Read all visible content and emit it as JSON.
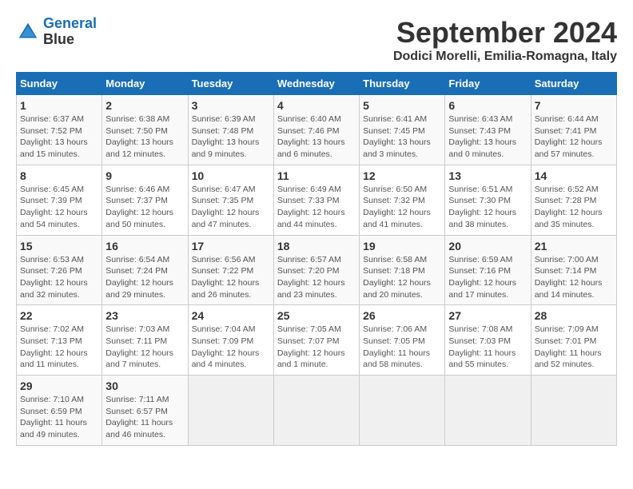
{
  "logo": {
    "line1": "General",
    "line2": "Blue"
  },
  "title": "September 2024",
  "subtitle": "Dodici Morelli, Emilia-Romagna, Italy",
  "days_of_week": [
    "Sunday",
    "Monday",
    "Tuesday",
    "Wednesday",
    "Thursday",
    "Friday",
    "Saturday"
  ],
  "weeks": [
    [
      {
        "day": "1",
        "sunrise": "Sunrise: 6:37 AM",
        "sunset": "Sunset: 7:52 PM",
        "daylight": "Daylight: 13 hours and 15 minutes."
      },
      {
        "day": "2",
        "sunrise": "Sunrise: 6:38 AM",
        "sunset": "Sunset: 7:50 PM",
        "daylight": "Daylight: 13 hours and 12 minutes."
      },
      {
        "day": "3",
        "sunrise": "Sunrise: 6:39 AM",
        "sunset": "Sunset: 7:48 PM",
        "daylight": "Daylight: 13 hours and 9 minutes."
      },
      {
        "day": "4",
        "sunrise": "Sunrise: 6:40 AM",
        "sunset": "Sunset: 7:46 PM",
        "daylight": "Daylight: 13 hours and 6 minutes."
      },
      {
        "day": "5",
        "sunrise": "Sunrise: 6:41 AM",
        "sunset": "Sunset: 7:45 PM",
        "daylight": "Daylight: 13 hours and 3 minutes."
      },
      {
        "day": "6",
        "sunrise": "Sunrise: 6:43 AM",
        "sunset": "Sunset: 7:43 PM",
        "daylight": "Daylight: 13 hours and 0 minutes."
      },
      {
        "day": "7",
        "sunrise": "Sunrise: 6:44 AM",
        "sunset": "Sunset: 7:41 PM",
        "daylight": "Daylight: 12 hours and 57 minutes."
      }
    ],
    [
      {
        "day": "8",
        "sunrise": "Sunrise: 6:45 AM",
        "sunset": "Sunset: 7:39 PM",
        "daylight": "Daylight: 12 hours and 54 minutes."
      },
      {
        "day": "9",
        "sunrise": "Sunrise: 6:46 AM",
        "sunset": "Sunset: 7:37 PM",
        "daylight": "Daylight: 12 hours and 50 minutes."
      },
      {
        "day": "10",
        "sunrise": "Sunrise: 6:47 AM",
        "sunset": "Sunset: 7:35 PM",
        "daylight": "Daylight: 12 hours and 47 minutes."
      },
      {
        "day": "11",
        "sunrise": "Sunrise: 6:49 AM",
        "sunset": "Sunset: 7:33 PM",
        "daylight": "Daylight: 12 hours and 44 minutes."
      },
      {
        "day": "12",
        "sunrise": "Sunrise: 6:50 AM",
        "sunset": "Sunset: 7:32 PM",
        "daylight": "Daylight: 12 hours and 41 minutes."
      },
      {
        "day": "13",
        "sunrise": "Sunrise: 6:51 AM",
        "sunset": "Sunset: 7:30 PM",
        "daylight": "Daylight: 12 hours and 38 minutes."
      },
      {
        "day": "14",
        "sunrise": "Sunrise: 6:52 AM",
        "sunset": "Sunset: 7:28 PM",
        "daylight": "Daylight: 12 hours and 35 minutes."
      }
    ],
    [
      {
        "day": "15",
        "sunrise": "Sunrise: 6:53 AM",
        "sunset": "Sunset: 7:26 PM",
        "daylight": "Daylight: 12 hours and 32 minutes."
      },
      {
        "day": "16",
        "sunrise": "Sunrise: 6:54 AM",
        "sunset": "Sunset: 7:24 PM",
        "daylight": "Daylight: 12 hours and 29 minutes."
      },
      {
        "day": "17",
        "sunrise": "Sunrise: 6:56 AM",
        "sunset": "Sunset: 7:22 PM",
        "daylight": "Daylight: 12 hours and 26 minutes."
      },
      {
        "day": "18",
        "sunrise": "Sunrise: 6:57 AM",
        "sunset": "Sunset: 7:20 PM",
        "daylight": "Daylight: 12 hours and 23 minutes."
      },
      {
        "day": "19",
        "sunrise": "Sunrise: 6:58 AM",
        "sunset": "Sunset: 7:18 PM",
        "daylight": "Daylight: 12 hours and 20 minutes."
      },
      {
        "day": "20",
        "sunrise": "Sunrise: 6:59 AM",
        "sunset": "Sunset: 7:16 PM",
        "daylight": "Daylight: 12 hours and 17 minutes."
      },
      {
        "day": "21",
        "sunrise": "Sunrise: 7:00 AM",
        "sunset": "Sunset: 7:14 PM",
        "daylight": "Daylight: 12 hours and 14 minutes."
      }
    ],
    [
      {
        "day": "22",
        "sunrise": "Sunrise: 7:02 AM",
        "sunset": "Sunset: 7:13 PM",
        "daylight": "Daylight: 12 hours and 11 minutes."
      },
      {
        "day": "23",
        "sunrise": "Sunrise: 7:03 AM",
        "sunset": "Sunset: 7:11 PM",
        "daylight": "Daylight: 12 hours and 7 minutes."
      },
      {
        "day": "24",
        "sunrise": "Sunrise: 7:04 AM",
        "sunset": "Sunset: 7:09 PM",
        "daylight": "Daylight: 12 hours and 4 minutes."
      },
      {
        "day": "25",
        "sunrise": "Sunrise: 7:05 AM",
        "sunset": "Sunset: 7:07 PM",
        "daylight": "Daylight: 12 hours and 1 minute."
      },
      {
        "day": "26",
        "sunrise": "Sunrise: 7:06 AM",
        "sunset": "Sunset: 7:05 PM",
        "daylight": "Daylight: 11 hours and 58 minutes."
      },
      {
        "day": "27",
        "sunrise": "Sunrise: 7:08 AM",
        "sunset": "Sunset: 7:03 PM",
        "daylight": "Daylight: 11 hours and 55 minutes."
      },
      {
        "day": "28",
        "sunrise": "Sunrise: 7:09 AM",
        "sunset": "Sunset: 7:01 PM",
        "daylight": "Daylight: 11 hours and 52 minutes."
      }
    ],
    [
      {
        "day": "29",
        "sunrise": "Sunrise: 7:10 AM",
        "sunset": "Sunset: 6:59 PM",
        "daylight": "Daylight: 11 hours and 49 minutes."
      },
      {
        "day": "30",
        "sunrise": "Sunrise: 7:11 AM",
        "sunset": "Sunset: 6:57 PM",
        "daylight": "Daylight: 11 hours and 46 minutes."
      },
      null,
      null,
      null,
      null,
      null
    ]
  ]
}
